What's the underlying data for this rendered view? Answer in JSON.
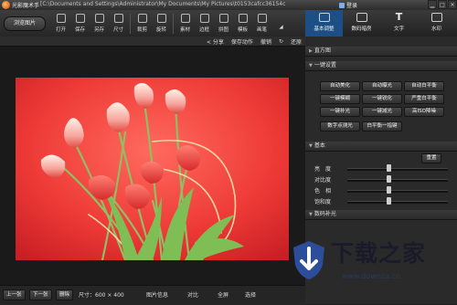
{
  "window": {
    "app_title": "光影魔术手",
    "path": "[C:\\Documents and Settings\\Administrator\\My Documents\\My Pictures\\t0153cafcc36154c",
    "login": "登录",
    "min": "▁",
    "max": "□",
    "close": "✕"
  },
  "toolbar": {
    "browse": "浏览图片",
    "tools": [
      "打开",
      "保存",
      "另存",
      "尺寸",
      "裁剪",
      "旋转",
      "素材",
      "边框",
      "拼图",
      "模板",
      "画笔"
    ],
    "more": "◢"
  },
  "right_tabs": [
    {
      "label": "基本调整",
      "active": true
    },
    {
      "label": "数码暗房",
      "active": false
    },
    {
      "label": "文字",
      "active": false
    },
    {
      "label": "水印",
      "active": false
    }
  ],
  "subbar": {
    "share": "< 分享",
    "save_action": "保存动作",
    "undo": "撤销",
    "redo": "↻",
    "restore": "还原"
  },
  "panel": {
    "histogram": "直方图",
    "one_click": "一键设置",
    "buttons": [
      "自动美化",
      "自动曝光",
      "自动白平衡",
      "一键模糊",
      "一键锐化",
      "严重白平衡",
      "一键补光",
      "一键减光",
      "高ISO降噪",
      "数字点测光",
      "白平衡一指键"
    ],
    "basic": "基本",
    "reset": "重置",
    "sliders": [
      {
        "label": "亮　度",
        "value": 0
      },
      {
        "label": "对比度",
        "value": 0
      },
      {
        "label": "色　相",
        "value": 0
      },
      {
        "label": "饱和度",
        "value": 0
      }
    ],
    "more": "数码补光"
  },
  "status": {
    "prev": "上一张",
    "next": "下一张",
    "delete": "删除",
    "size": "尺寸：600 × 400",
    "info": "图片信息",
    "compare": "对比",
    "fullscreen": "全屏",
    "crop": "选择"
  },
  "watermark": {
    "text": "下载之家",
    "url": "www.downza.cn"
  }
}
